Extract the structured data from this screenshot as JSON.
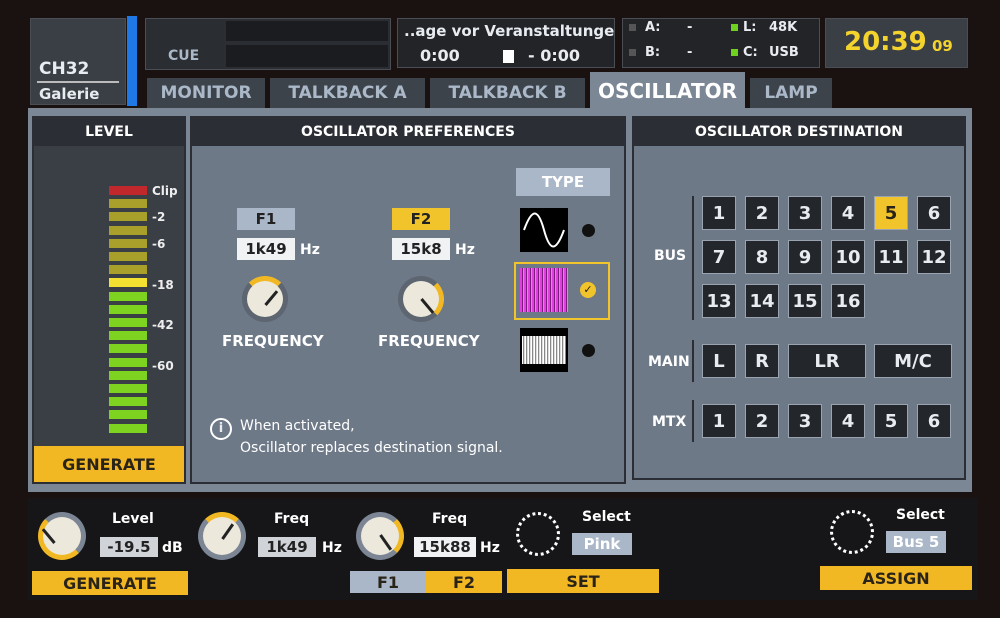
{
  "channel": {
    "id": "CH32",
    "name": "Galerie",
    "color": "#1e78e6"
  },
  "cue": {
    "label": "CUE"
  },
  "player": {
    "title": "..age vor Veranstaltunge",
    "elapsed": "0:00",
    "remaining": "- 0:00",
    "stop_icon": "stop-icon"
  },
  "sources": [
    {
      "label": "A:",
      "value": "-",
      "active": false
    },
    {
      "label": "B:",
      "value": "-",
      "active": false
    },
    {
      "label": "L:",
      "value": "48K",
      "active": true
    },
    {
      "label": "C:",
      "value": "USB",
      "active": true
    }
  ],
  "clock": {
    "time": "20:39",
    "seconds": "09"
  },
  "tabs": [
    {
      "label": "MONITOR"
    },
    {
      "label": "TALKBACK A"
    },
    {
      "label": "TALKBACK B"
    },
    {
      "label": "OSCILLATOR",
      "active": true
    },
    {
      "label": "LAMP"
    }
  ],
  "level": {
    "title": "LEVEL",
    "scale": [
      "Clip",
      "-2",
      "-6",
      "-18",
      "-42",
      "-60"
    ],
    "generate": "GENERATE"
  },
  "prefs": {
    "title": "OSCILLATOR PREFERENCES",
    "f1": {
      "label": "F1",
      "value": "1k49",
      "unit": "Hz",
      "knob": "FREQUENCY"
    },
    "f2": {
      "label": "F2",
      "value": "15k8",
      "unit": "Hz",
      "knob": "FREQUENCY"
    },
    "type_label": "TYPE",
    "types": [
      "sine",
      "pink",
      "white"
    ],
    "selected_type": "pink",
    "info_line1": "When activated,",
    "info_line2": "Oscillator replaces destination signal."
  },
  "dest": {
    "title": "OSCILLATOR DESTINATION",
    "bus_label": "BUS",
    "bus": [
      "1",
      "2",
      "3",
      "4",
      "5",
      "6",
      "7",
      "8",
      "9",
      "10",
      "11",
      "12",
      "13",
      "14",
      "15",
      "16"
    ],
    "bus_selected": "5",
    "main_label": "MAIN",
    "main": [
      "L",
      "R",
      "LR",
      "M/C"
    ],
    "mtx_label": "MTX",
    "mtx": [
      "1",
      "2",
      "3",
      "4",
      "5",
      "6"
    ]
  },
  "bottom": {
    "level": {
      "label": "Level",
      "value": "-19.5",
      "unit": "dB",
      "button": "GENERATE"
    },
    "freq1": {
      "label": "Freq",
      "value": "1k49",
      "unit": "Hz"
    },
    "freq2": {
      "label": "Freq",
      "value": "15k88",
      "unit": "Hz",
      "f1": "F1",
      "f2": "F2"
    },
    "select": {
      "label": "Select",
      "value": "Pink",
      "button": "SET"
    },
    "assign": {
      "label": "Select",
      "value": "Bus 5",
      "button": "ASSIGN"
    }
  },
  "colors": {
    "accent": "#f2b824",
    "panel": "#6e7988",
    "meter_green": "#7ed321",
    "meter_yellow": "#f4e030",
    "meter_clip": "#c0282c"
  }
}
